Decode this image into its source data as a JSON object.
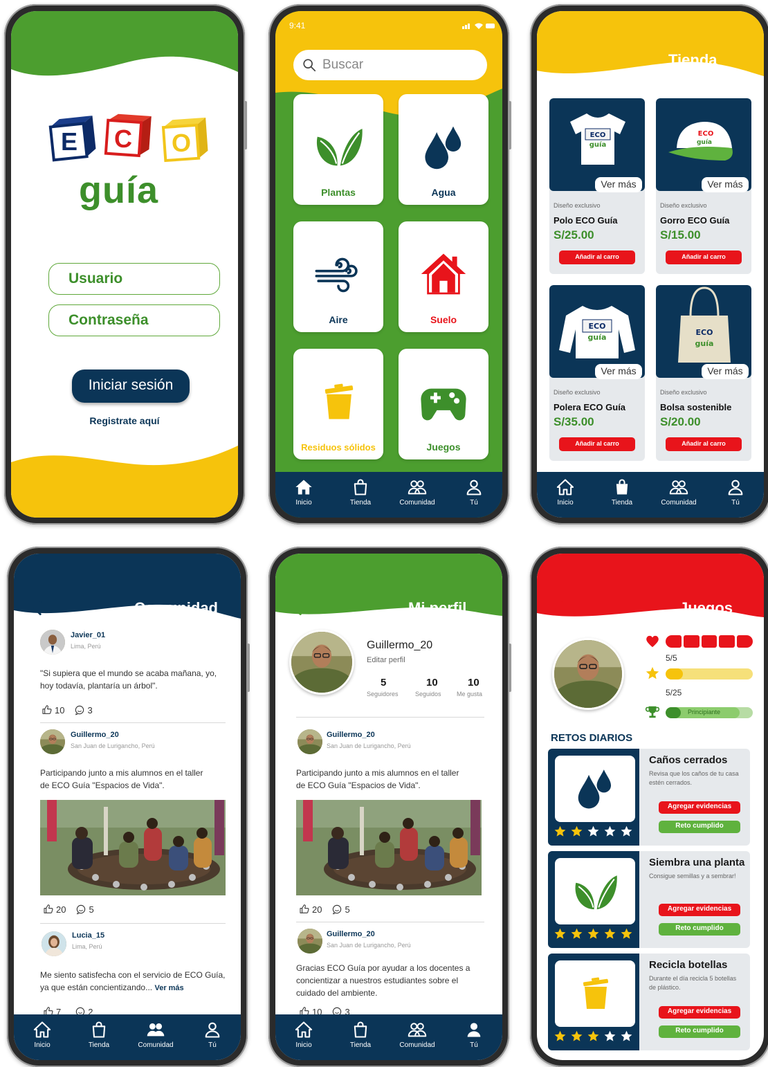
{
  "colors": {
    "green": "#4c9e2f",
    "yellow": "#f6c30c",
    "navy": "#0b3557",
    "red": "#e8141b"
  },
  "nav": {
    "home": "Inicio",
    "shop": "Tienda",
    "community": "Comunidad",
    "you": "Tú"
  },
  "login": {
    "logo_letters": [
      "E",
      "C",
      "O"
    ],
    "logo_word": "guía",
    "user_placeholder": "Usuario",
    "password_placeholder": "Contraseña",
    "login_button": "Iniciar sesión",
    "register_link": "Registrate aquí"
  },
  "home": {
    "status_time": "9:41",
    "search_placeholder": "Buscar",
    "tiles": [
      {
        "label": "Plantas",
        "icon": "leaves-icon",
        "color": "#3d8f2b"
      },
      {
        "label": "Agua",
        "icon": "drops-icon",
        "color": "#0b3557"
      },
      {
        "label": "Aire",
        "icon": "wind-icon",
        "color": "#0b3557"
      },
      {
        "label": "Suelo",
        "icon": "house-icon",
        "color": "#e8141b"
      },
      {
        "label": "Residuos sólidos",
        "icon": "trash-icon",
        "color": "#f6c30c"
      },
      {
        "label": "Juegos",
        "icon": "gamepad-icon",
        "color": "#3d8f2b"
      }
    ]
  },
  "shop": {
    "title": "Tienda",
    "more_label": "Ver más",
    "products": [
      {
        "tag": "Diseño exclusivo",
        "name": "Polo ECO Guía",
        "price": "S/25.00",
        "button": "Añadir al carro",
        "icon": "tshirt-icon"
      },
      {
        "tag": "Diseño exclusivo",
        "name": "Gorro ECO Guía",
        "price": "S/15.00",
        "button": "Añadir al carro",
        "icon": "cap-icon"
      },
      {
        "tag": "Diseño exclusivo",
        "name": "Polera ECO Guía",
        "price": "S/35.00",
        "button": "Añadir al carro",
        "icon": "sweater-icon"
      },
      {
        "tag": "Diseño exclusivo",
        "name": "Bolsa sostenible",
        "price": "S/20.00",
        "button": "Añadir al carro",
        "icon": "bag-icon"
      }
    ]
  },
  "community": {
    "title": "Comunidad",
    "posts": [
      {
        "user": "Javier_01",
        "location": "Lima, Perú",
        "text": "\"Si supiera que el mundo se acaba mañana, yo, hoy todavía, plantaría un árbol\".",
        "likes": "10",
        "comments": "3",
        "has_photo": false
      },
      {
        "user": "Guillermo_20",
        "location": "San Juan de Lurigancho, Perú",
        "text": "Participando junto a mis alumnos en el taller de ECO Guía \"Espacios de Vida\".",
        "likes": "20",
        "comments": "5",
        "has_photo": true
      },
      {
        "user": "Lucia_15",
        "location": "Lima, Perú",
        "text": "Me siento satisfecha con el servicio de ECO Guía, ya que están concientizando...",
        "more": "Ver más",
        "likes": "7",
        "comments": "2",
        "has_photo": false
      }
    ]
  },
  "profile": {
    "title": "Mi perfil",
    "username": "Guillermo_20",
    "edit": "Editar perfil",
    "stats": [
      {
        "value": "5",
        "label": "Seguidores"
      },
      {
        "value": "10",
        "label": "Seguidos"
      },
      {
        "value": "10",
        "label": "Me gusta"
      }
    ],
    "posts": [
      {
        "user": "Guillermo_20",
        "location": "San Juan de Lurigancho, Perú",
        "text": "Participando junto a mis alumnos en el taller de ECO Guía \"Espacios de Vida\".",
        "likes": "20",
        "comments": "5"
      },
      {
        "user": "Guillermo_20",
        "location": "San Juan de Lurigancho, Perú",
        "text": "Gracias ECO Guía por ayudar a los docentes a concientizar a nuestros estudiantes sobre el cuidado del ambiente.",
        "likes": "10",
        "comments": "3"
      }
    ]
  },
  "games": {
    "title": "Juegos",
    "lives": "5/5",
    "lives_fraction": 1.0,
    "stars": "5/25",
    "stars_fraction": 0.2,
    "level": "Principiante",
    "level_fraction": 0.85,
    "daily_title": "RETOS DIARIOS",
    "evidence_button": "Agregar evidencias",
    "done_button": "Reto cumplido",
    "challenges": [
      {
        "title": "Caños cerrados",
        "desc": "Revisa que los caños de tu casa estén cerrados.",
        "icon": "drops-icon",
        "stars_filled": 2
      },
      {
        "title": "Siembra una planta",
        "desc": "Consigue semillas y a sembrar!",
        "icon": "leaves-icon",
        "stars_filled": 5
      },
      {
        "title": "Recicla botellas",
        "desc": "Durante el día recicla 5 botellas de plástico.",
        "icon": "trash-icon",
        "stars_filled": 3
      }
    ]
  }
}
